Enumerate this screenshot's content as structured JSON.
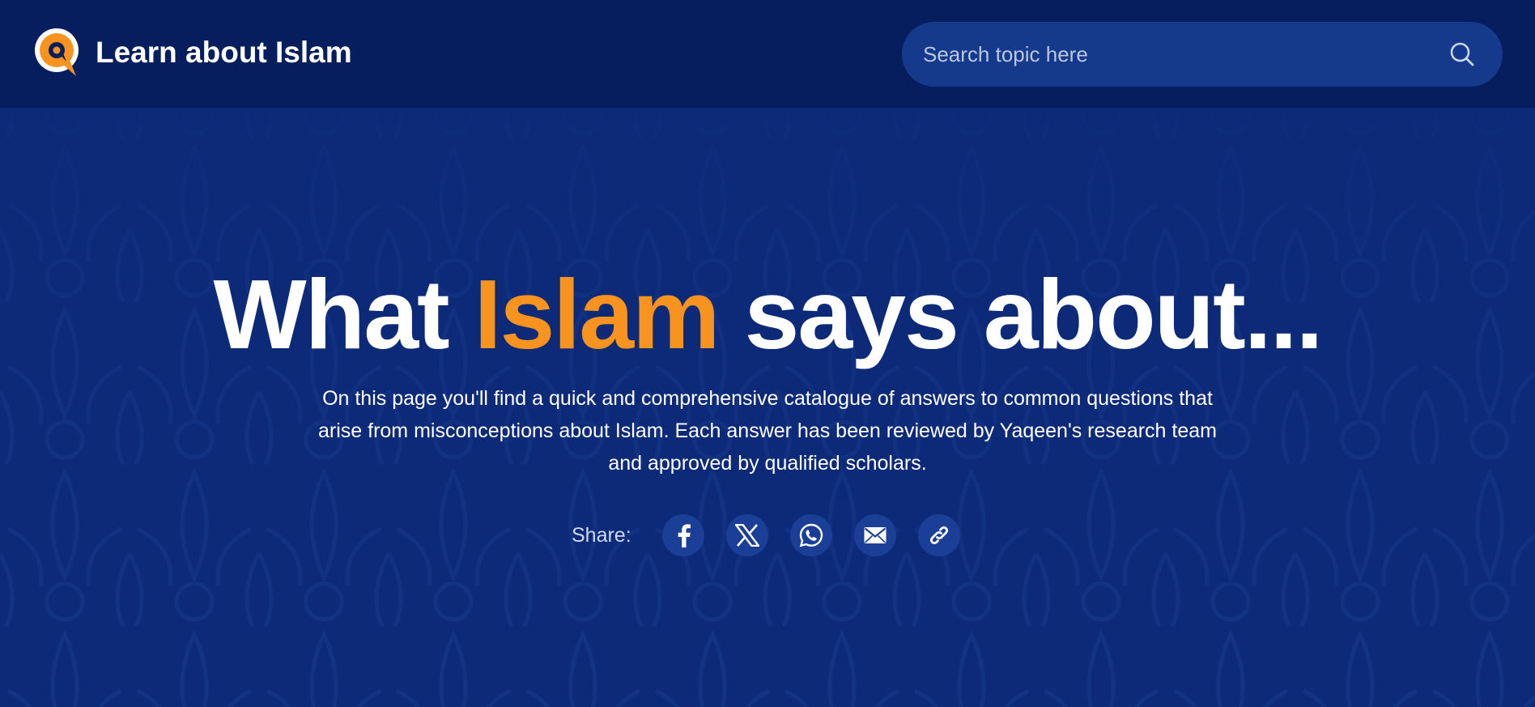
{
  "colors": {
    "header_bg": "#061e5e",
    "hero_bg": "#0c2a78",
    "accent": "#f7931e",
    "search_bg": "#153a8c",
    "share_button_bg": "#1b3f96"
  },
  "header": {
    "logo_icon": "q-speech-bubble-logo",
    "title": "Learn about Islam",
    "search": {
      "placeholder": "Search topic here",
      "value": "",
      "icon": "search-icon"
    }
  },
  "hero": {
    "headline": {
      "part1": "What ",
      "accent": "Islam",
      "part2": " says about..."
    },
    "intro": "On this page you'll find a quick and comprehensive catalogue of answers to common questions that arise from misconceptions about Islam. Each answer has been reviewed by Yaqeen's research team and approved by qualified scholars.",
    "share": {
      "label": "Share:",
      "buttons": [
        {
          "icon": "facebook-icon"
        },
        {
          "icon": "x-twitter-icon"
        },
        {
          "icon": "whatsapp-icon"
        },
        {
          "icon": "email-icon"
        },
        {
          "icon": "copy-link-icon"
        }
      ]
    }
  }
}
